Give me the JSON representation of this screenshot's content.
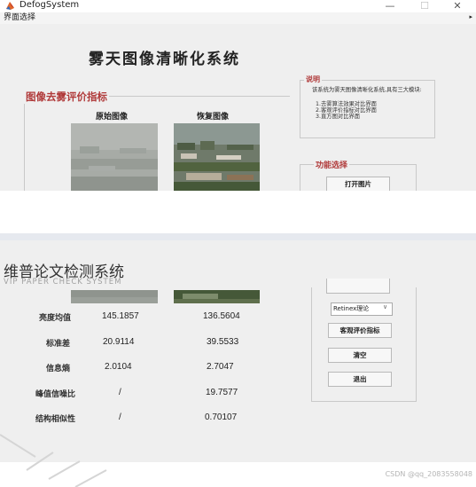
{
  "window": {
    "title": "DefogSystem",
    "minimize": "—",
    "maximize": "☐",
    "close": "✕"
  },
  "menu": {
    "item": "界面选择",
    "arrow": "▸"
  },
  "main_title": "雾天图像清晰化系统",
  "eval_panel": {
    "title": "图像去雾评价指标",
    "original_header": "原始图像",
    "restored_header": "恢复图像"
  },
  "description": {
    "title": "说明",
    "intro": "该系统为雾天图像清晰化系统,具有三大模块:",
    "items": [
      "1.去雾算法效果对比界面",
      "2.客观评价指标对比界面",
      "3.直方图对比界面"
    ]
  },
  "functions": {
    "title": "功能选择",
    "open_button": "打开图片",
    "method_select": "Retinex理论",
    "objective_button": "客观评价指标",
    "clear_button": "清空",
    "exit_button": "退出"
  },
  "metrics": [
    {
      "label": "亮度均值",
      "original": "145.1857",
      "restored": "136.5604"
    },
    {
      "label": "标准差",
      "original": "20.9114",
      "restored": "39.5533"
    },
    {
      "label": "信息熵",
      "original": "2.0104",
      "restored": "2.7047"
    },
    {
      "label": "峰值信噪比",
      "original": "/",
      "restored": "19.7577"
    },
    {
      "label": "结构相似性",
      "original": "/",
      "restored": "0.70107"
    }
  ],
  "watermark": {
    "title": "维普论文检测系统",
    "subtitle": "VIP PAPER CHECK SYSTEM"
  },
  "credit": "CSDN @qq_2083558048",
  "colors": {
    "panel_title": "#b03a3a",
    "canvas": "#efefef",
    "border": "#c9c9c9"
  }
}
